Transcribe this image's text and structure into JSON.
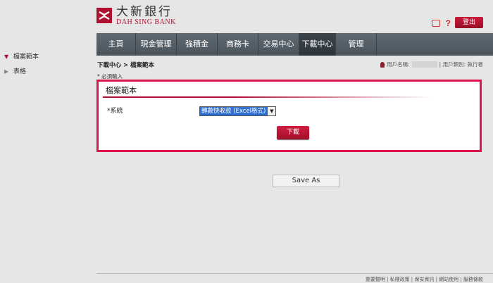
{
  "sidebar": {
    "items": [
      {
        "label": "檔案範本",
        "active": true
      },
      {
        "label": "表格",
        "active": false
      }
    ]
  },
  "header": {
    "logo_cn": "大新銀行",
    "logo_en": "DAH SING BANK",
    "logout_label": "登出"
  },
  "nav": {
    "items": [
      {
        "label": "主頁"
      },
      {
        "label": "現金管理"
      },
      {
        "label": "強積金"
      },
      {
        "label": "商務卡"
      },
      {
        "label": "交易中心"
      },
      {
        "label": "下載中心"
      },
      {
        "label": "管理"
      }
    ],
    "active_index": 5
  },
  "breadcrumb": "下載中心 > 檔案範本",
  "user_info": {
    "username_label": "用戶名稱:",
    "role_text": "| 用戶類別: 執行者"
  },
  "required_note": "* 必須輸入",
  "panel": {
    "title": "檔案範本",
    "field_label": "*系統",
    "select_value": "轉數快收款 (Excel格式)",
    "download_label": "下載"
  },
  "save_as_label": "Save As",
  "footer": {
    "text": "重要聲明 | 私隱政策 | 保安資訊 | 網站使用 | 服務條款"
  },
  "colors": {
    "brand_red": "#b01030",
    "highlight_border": "#e0144c",
    "nav_bg": "#55606a"
  }
}
